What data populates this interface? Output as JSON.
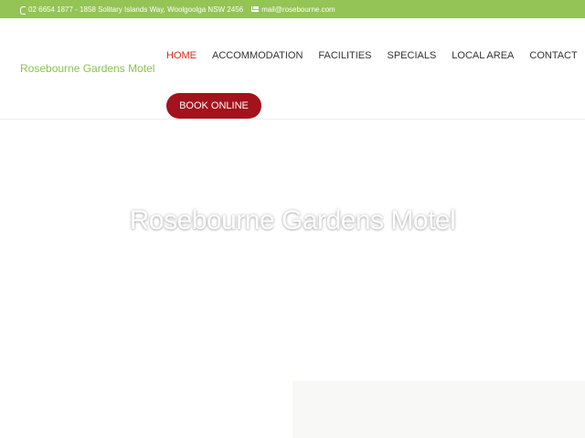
{
  "topbar": {
    "phone_text": "02 6654 1877 - 1858 Solitary Islands Way, Woolgoolga NSW 2456",
    "email_text": "mail@rosebourne.com",
    "phone_icon": "phone-icon",
    "email_icon": "mail-icon",
    "background": "#94c356"
  },
  "header": {
    "logo_text": "Rosebourne Gardens Motel",
    "nav": [
      {
        "label": "HOME",
        "active": true
      },
      {
        "label": "ACCOMMODATION",
        "active": false
      },
      {
        "label": "FACILITIES",
        "active": false
      },
      {
        "label": "SPECIALS",
        "active": false
      },
      {
        "label": "LOCAL AREA",
        "active": false
      },
      {
        "label": "CONTACT",
        "active": false
      }
    ],
    "book_label": "BOOK ONLINE",
    "accent_color": "#d42b1e",
    "book_color": "#a4121c",
    "logo_color": "#8dc04f"
  },
  "hero": {
    "title": "Rosebourne Gardens Motel"
  }
}
